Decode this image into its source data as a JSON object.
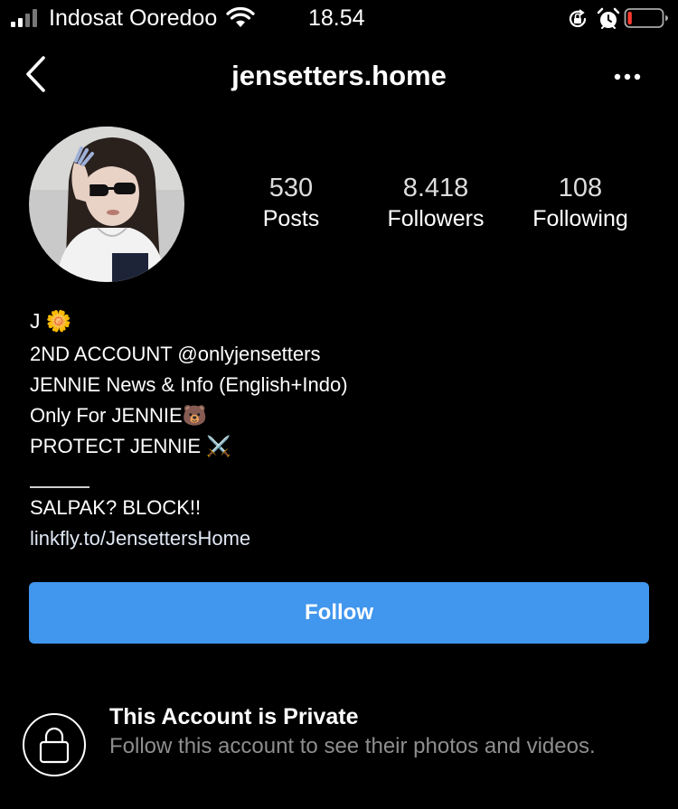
{
  "status_bar": {
    "carrier": "Indosat Ooredoo",
    "time": "18.54",
    "icons": [
      "signal-icon",
      "wifi-icon",
      "rotation-lock-icon",
      "alarm-icon",
      "battery-icon"
    ],
    "battery_level": 0.12,
    "battery_color": "#ff3b30"
  },
  "header": {
    "username": "jensetters.home",
    "back_icon": "chevron-left-icon",
    "more_icon": "more-horizontal-icon"
  },
  "stats": [
    {
      "value": "530",
      "label": "Posts"
    },
    {
      "value": "8.418",
      "label": "Followers"
    },
    {
      "value": "108",
      "label": "Following"
    }
  ],
  "bio": {
    "name": "J",
    "name_emoji": "🌼",
    "lines": [
      "2ND ACCOUNT @onlyjensetters",
      "JENNIE News & Info (English+Indo)",
      "Only For JENNIE🐻",
      "PROTECT JENNIE ⚔️"
    ],
    "after_divider": "SALPAK? BLOCK!!",
    "link": "linkfly.to/JensettersHome"
  },
  "follow_button": {
    "label": "Follow",
    "color": "#4196ed"
  },
  "private_notice": {
    "icon": "lock-icon",
    "title": "This Account is Private",
    "description": "Follow this account to see their photos and videos."
  }
}
